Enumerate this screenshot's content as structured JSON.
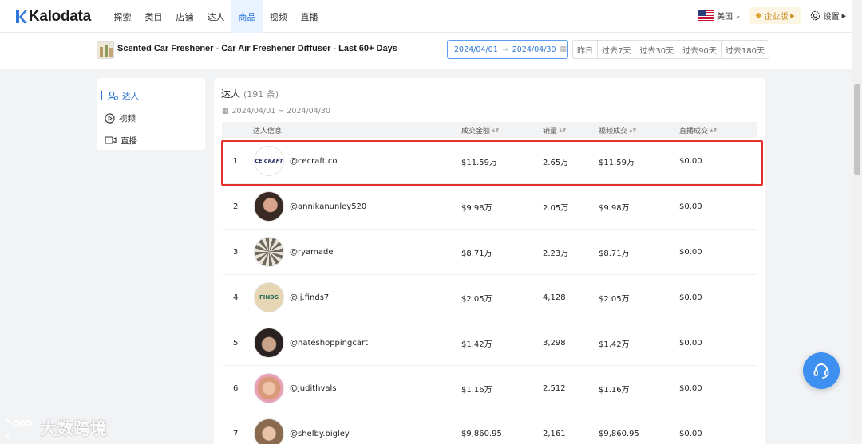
{
  "brand": {
    "name": "Kalodata"
  },
  "nav": {
    "items": [
      {
        "label": "探索",
        "active": false
      },
      {
        "label": "类目",
        "active": false
      },
      {
        "label": "店铺",
        "active": false
      },
      {
        "label": "达人",
        "active": false
      },
      {
        "label": "商品",
        "active": true
      },
      {
        "label": "视频",
        "active": false
      },
      {
        "label": "直播",
        "active": false
      }
    ],
    "region": "美国",
    "enterprise": "企业版",
    "settings": "设置"
  },
  "product": {
    "title": "Scented Car Freshener - Car Air Freshener Diffuser - Last 60+ Days"
  },
  "date_range": {
    "start": "2024/04/01",
    "arrow": "→",
    "end": "2024/04/30"
  },
  "quick_ranges": [
    "昨日",
    "过去7天",
    "过去30天",
    "过去90天",
    "过去180天"
  ],
  "side_menu": [
    {
      "label": "达人",
      "icon": "creator-icon",
      "active": true
    },
    {
      "label": "视频",
      "icon": "play-icon",
      "active": false
    },
    {
      "label": "直播",
      "icon": "video-camera-icon",
      "active": false
    }
  ],
  "panel": {
    "title": "达人",
    "count": "(191 条)",
    "date_text": "2024/04/01 ~ 2024/04/30"
  },
  "table": {
    "headers": {
      "creator": "达人信息",
      "gmv": "成交金额",
      "sales": "销量",
      "video_gmv": "视频成交",
      "live_gmv": "直播成交"
    },
    "rows": [
      {
        "rank": "1",
        "handle": "@cecraft.co",
        "gmv": "$11.59万",
        "sales": "2.65万",
        "video_gmv": "$11.59万",
        "live_gmv": "$0.00",
        "avatar_text": "CE CRAFT"
      },
      {
        "rank": "2",
        "handle": "@annikanunley520",
        "gmv": "$9.98万",
        "sales": "2.05万",
        "video_gmv": "$9.98万",
        "live_gmv": "$0.00"
      },
      {
        "rank": "3",
        "handle": "@ryamade",
        "gmv": "$8.71万",
        "sales": "2.23万",
        "video_gmv": "$8.71万",
        "live_gmv": "$0.00"
      },
      {
        "rank": "4",
        "handle": "@jj.finds7",
        "gmv": "$2.05万",
        "sales": "4,128",
        "video_gmv": "$2.05万",
        "live_gmv": "$0.00",
        "avatar_text": "FINDS"
      },
      {
        "rank": "5",
        "handle": "@nateshoppingcart",
        "gmv": "$1.42万",
        "sales": "3,298",
        "video_gmv": "$1.42万",
        "live_gmv": "$0.00"
      },
      {
        "rank": "6",
        "handle": "@judithvals",
        "gmv": "$1.16万",
        "sales": "2,512",
        "video_gmv": "$1.16万",
        "live_gmv": "$0.00"
      },
      {
        "rank": "7",
        "handle": "@shelby.bigley",
        "gmv": "$9,860.95",
        "sales": "2,161",
        "video_gmv": "$9,860.95",
        "live_gmv": "$0.00"
      }
    ]
  },
  "watermark": {
    "text": "大数跨境"
  },
  "colors": {
    "accent": "#2e77d8",
    "highlight": "#e0312a",
    "support": "#3d8ff0"
  }
}
